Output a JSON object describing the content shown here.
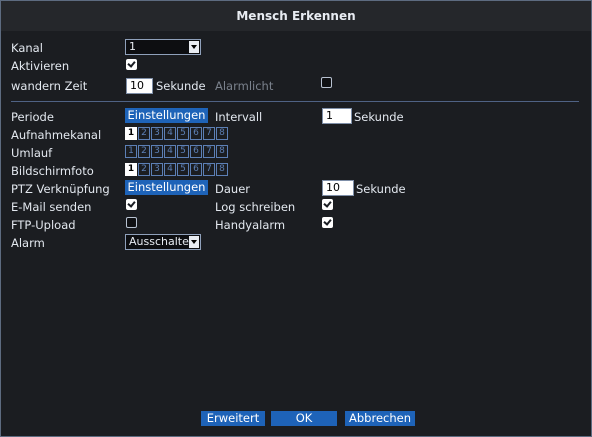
{
  "window": {
    "title": "Mensch Erkennen"
  },
  "labels": {
    "kanal": "Kanal",
    "aktivieren": "Aktivieren",
    "wandern_zeit": "wandern Zeit",
    "sekunde": "Sekunde",
    "alarmlicht": "Alarmlicht",
    "periode": "Periode",
    "intervall": "Intervall",
    "aufnahmekanal": "Aufnahmekanal",
    "umlauf": "Umlauf",
    "bildschirmfoto": "Bildschirmfoto",
    "ptz": "PTZ Verknüpfung",
    "dauer": "Dauer",
    "email": "E-Mail senden",
    "log": "Log schreiben",
    "ftp": "FTP-Upload",
    "handyalarm": "Handyalarm",
    "alarm": "Alarm"
  },
  "fields": {
    "kanal_value": "1",
    "wandern_zeit_value": "10",
    "intervall_value": "1",
    "dauer_value": "10",
    "alarm_value": "Ausschalte"
  },
  "checkboxes": {
    "aktivieren": true,
    "alarmlicht": false,
    "email": true,
    "log": true,
    "ftp": false,
    "handyalarm": true
  },
  "buttons": {
    "einstellungen_periode": "Einstellungen",
    "einstellungen_ptz": "Einstellungen",
    "erweitert": "Erweitert",
    "ok": "OK",
    "abbrechen": "Abbrechen"
  },
  "channels": {
    "numbers": [
      "1",
      "2",
      "3",
      "4",
      "5",
      "6",
      "7",
      "8"
    ],
    "aufnahmekanal_selected": [
      "1"
    ],
    "umlauf_selected": [],
    "bildschirmfoto_selected": [
      "1"
    ]
  },
  "icons": {
    "dropdown": "chevron-down-icon",
    "checkbox": "checkbox-icon"
  },
  "colors": {
    "accent": "#1e63b8",
    "background": "#1b1d21",
    "channel_border": "#5c7fb5"
  }
}
